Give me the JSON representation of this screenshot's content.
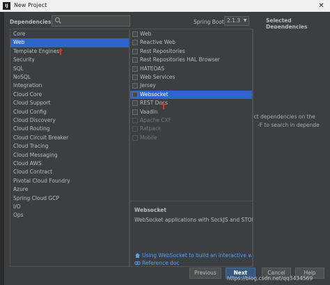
{
  "window": {
    "title": "New Project",
    "app_icon": "IJ"
  },
  "header": {
    "dependencies_label": "Dependencies",
    "search": {
      "value": "",
      "placeholder": ""
    },
    "spring_boot_label": "Spring Boot",
    "spring_boot_version": "2.1.3",
    "selected_label": "Selected Dependencies"
  },
  "categories": [
    "Core",
    "Web",
    "Template Engines",
    "Security",
    "SQL",
    "NoSQL",
    "Integration",
    "Cloud Core",
    "Cloud Support",
    "Cloud Config",
    "Cloud Discovery",
    "Cloud Routing",
    "Cloud Circuit Breaker",
    "Cloud Tracing",
    "Cloud Messaging",
    "Cloud AWS",
    "Cloud Contract",
    "Pivotal Cloud Foundry",
    "Azure",
    "Spring Cloud GCP",
    "I/O",
    "Ops"
  ],
  "selected_category": "Web",
  "dependencies": [
    {
      "label": "Web",
      "checked": false,
      "disabled": false
    },
    {
      "label": "Reactive Web",
      "checked": false,
      "disabled": false
    },
    {
      "label": "Rest Repositories",
      "checked": false,
      "disabled": false
    },
    {
      "label": "Rest Repositories HAL Browser",
      "checked": false,
      "disabled": false
    },
    {
      "label": "HATEOAS",
      "checked": false,
      "disabled": false
    },
    {
      "label": "Web Services",
      "checked": false,
      "disabled": false
    },
    {
      "label": "Jersey",
      "checked": false,
      "disabled": false
    },
    {
      "label": "Websocket",
      "checked": false,
      "disabled": false
    },
    {
      "label": "REST Docs",
      "checked": false,
      "disabled": false
    },
    {
      "label": "Vaadin",
      "checked": false,
      "disabled": false
    },
    {
      "label": "Apache CXF",
      "checked": false,
      "disabled": true
    },
    {
      "label": "Ratpack",
      "checked": false,
      "disabled": true
    },
    {
      "label": "Mobile",
      "checked": false,
      "disabled": true
    }
  ],
  "selected_dependency": "Websocket",
  "description": {
    "title": "Websocket",
    "text": "WebSocket applications with SockJS and STOMP",
    "guide_link": "Using WebSocket to build an interactive web applica",
    "reference_link": "Reference doc"
  },
  "selected_panel": {
    "hint_line1": "ect dependencies on the",
    "hint_line2": "-F to search in depende"
  },
  "buttons": {
    "previous": "Previous",
    "next": "Next",
    "cancel": "Cancel",
    "help": "Help"
  },
  "watermark": "https://blog.csdn.net/qq3434569",
  "colors": {
    "selection": "#2f65ca",
    "link": "#589df6",
    "annotation_arrow": "#e03030",
    "primary_button": "#365880"
  }
}
